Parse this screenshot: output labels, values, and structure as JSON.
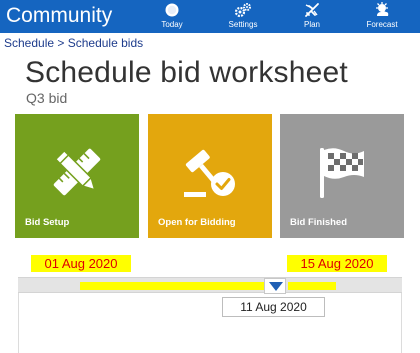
{
  "app": {
    "title": "Community"
  },
  "nav": {
    "today": {
      "label": "Today",
      "icon": "sun-icon"
    },
    "settings": {
      "label": "Settings",
      "icon": "gears-icon"
    },
    "plan": {
      "label": "Plan",
      "icon": "plane-icon"
    },
    "forecast": {
      "label": "Forecast",
      "icon": "weather-forecast-icon"
    }
  },
  "breadcrumb": {
    "parent": "Schedule",
    "separator": " > ",
    "current": "Schedule bids"
  },
  "page": {
    "title": "Schedule bid worksheet",
    "subtitle": "Q3 bid"
  },
  "tiles": [
    {
      "label": "Bid Setup",
      "icon": "pencil-ruler-icon",
      "color": "#75a01e"
    },
    {
      "label": "Open for Bidding",
      "icon": "gavel-check-icon",
      "color": "#e3a70d"
    },
    {
      "label": "Bid Finished",
      "icon": "checkered-flag-icon",
      "color": "#9a9a9a"
    }
  ],
  "timeline": {
    "start_date": "01 Aug 2020",
    "end_date": "15 Aug 2020",
    "current_date": "11 Aug 2020",
    "highlight_color": "#ffff00",
    "date_text_color": "#e00000",
    "marker_icon": "triangle-down-icon"
  },
  "colors": {
    "header": "#1565c0",
    "breadcrumb": "#1e3c8c"
  }
}
